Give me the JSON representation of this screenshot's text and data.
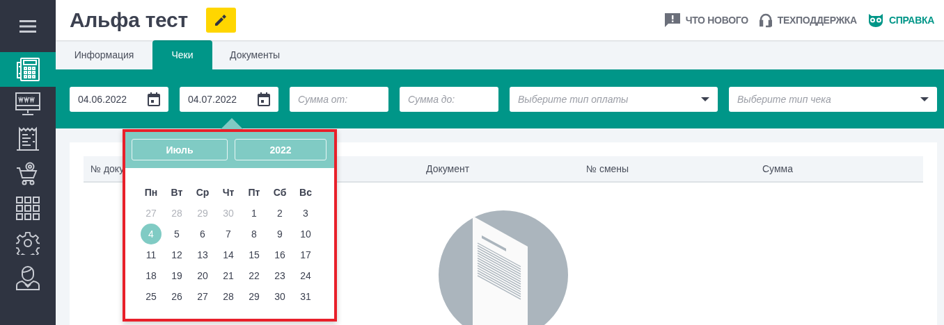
{
  "sidebar": {
    "items": [
      {
        "selected": true
      },
      {
        "selected": false
      },
      {
        "selected": false
      },
      {
        "selected": false
      },
      {
        "selected": false
      },
      {
        "selected": false
      },
      {
        "selected": false
      }
    ]
  },
  "header": {
    "title": "Альфа тест",
    "links": [
      {
        "label": "ЧТО НОВОГО",
        "color": "#6b6f7a"
      },
      {
        "label": "ТЕХПОДДЕРЖКА",
        "color": "#6b6f7a"
      },
      {
        "label": "СПРАВКА",
        "color": "#009688"
      }
    ]
  },
  "tabs": [
    {
      "label": "Информация",
      "selected": false
    },
    {
      "label": "Чеки",
      "selected": true
    },
    {
      "label": "Документы",
      "selected": false
    }
  ],
  "filters": [
    {
      "kind": "date",
      "value": "04.06.2022"
    },
    {
      "kind": "date",
      "value": "04.07.2022"
    },
    {
      "kind": "number",
      "placeholder": "Сумма от:"
    },
    {
      "kind": "number",
      "placeholder": "Сумма до:"
    },
    {
      "kind": "select",
      "placeholder": "Выберите тип оплаты"
    },
    {
      "kind": "select",
      "placeholder": "Выберите тип чека"
    }
  ],
  "table": {
    "columns": [
      "№ доку",
      "Документ",
      "№ смены",
      "Сумма"
    ]
  },
  "calendar": {
    "highlighted": true,
    "month": "Июль",
    "year": "2022",
    "weekdays": [
      "Пн",
      "Вт",
      "Ср",
      "Чт",
      "Пт",
      "Сб",
      "Вс"
    ],
    "weeks": [
      [
        {
          "day": "27",
          "muted": true,
          "selected": false
        },
        {
          "day": "28",
          "muted": true,
          "selected": false
        },
        {
          "day": "29",
          "muted": true,
          "selected": false
        },
        {
          "day": "30",
          "muted": true,
          "selected": false
        },
        {
          "day": "1",
          "muted": false,
          "selected": false
        },
        {
          "day": "2",
          "muted": false,
          "selected": false
        },
        {
          "day": "3",
          "muted": false,
          "selected": false
        }
      ],
      [
        {
          "day": "4",
          "muted": false,
          "selected": true
        },
        {
          "day": "5",
          "muted": false,
          "selected": false
        },
        {
          "day": "6",
          "muted": false,
          "selected": false
        },
        {
          "day": "7",
          "muted": false,
          "selected": false
        },
        {
          "day": "8",
          "muted": false,
          "selected": false
        },
        {
          "day": "9",
          "muted": false,
          "selected": false
        },
        {
          "day": "10",
          "muted": false,
          "selected": false
        }
      ],
      [
        {
          "day": "11",
          "muted": false,
          "selected": false
        },
        {
          "day": "12",
          "muted": false,
          "selected": false
        },
        {
          "day": "13",
          "muted": false,
          "selected": false
        },
        {
          "day": "14",
          "muted": false,
          "selected": false
        },
        {
          "day": "15",
          "muted": false,
          "selected": false
        },
        {
          "day": "16",
          "muted": false,
          "selected": false
        },
        {
          "day": "17",
          "muted": false,
          "selected": false
        }
      ],
      [
        {
          "day": "18",
          "muted": false,
          "selected": false
        },
        {
          "day": "19",
          "muted": false,
          "selected": false
        },
        {
          "day": "20",
          "muted": false,
          "selected": false
        },
        {
          "day": "21",
          "muted": false,
          "selected": false
        },
        {
          "day": "22",
          "muted": false,
          "selected": false
        },
        {
          "day": "23",
          "muted": false,
          "selected": false
        },
        {
          "day": "24",
          "muted": false,
          "selected": false
        }
      ],
      [
        {
          "day": "25",
          "muted": false,
          "selected": false
        },
        {
          "day": "26",
          "muted": false,
          "selected": false
        },
        {
          "day": "27",
          "muted": false,
          "selected": false
        },
        {
          "day": "28",
          "muted": false,
          "selected": false
        },
        {
          "day": "29",
          "muted": false,
          "selected": false
        },
        {
          "day": "30",
          "muted": false,
          "selected": false
        },
        {
          "day": "31",
          "muted": false,
          "selected": false
        }
      ]
    ]
  }
}
